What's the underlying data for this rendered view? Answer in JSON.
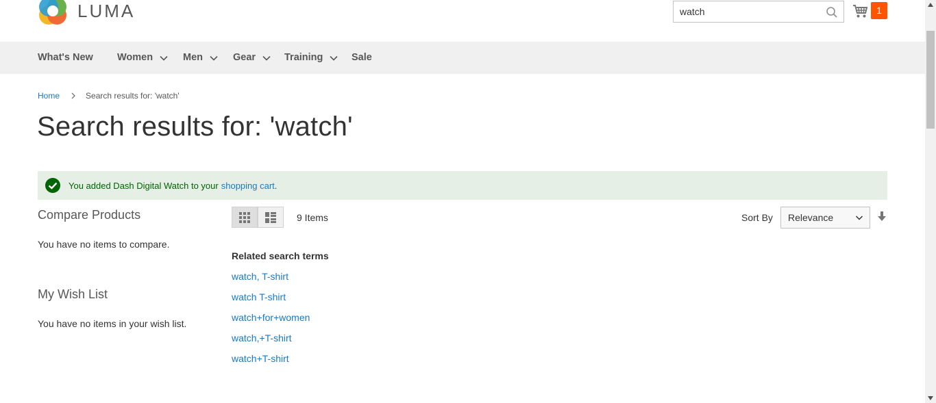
{
  "header": {
    "logo_text": "LUMA",
    "search_value": "watch",
    "cart_count": "1"
  },
  "nav": {
    "items": [
      {
        "label": "What's New",
        "has_dropdown": false
      },
      {
        "label": "Women",
        "has_dropdown": true
      },
      {
        "label": "Men",
        "has_dropdown": true
      },
      {
        "label": "Gear",
        "has_dropdown": true
      },
      {
        "label": "Training",
        "has_dropdown": true
      },
      {
        "label": "Sale",
        "has_dropdown": false
      }
    ]
  },
  "breadcrumb": {
    "home": "Home",
    "current": "Search results for: 'watch'"
  },
  "page_title": "Search results for: 'watch'",
  "message": {
    "text": "You added Dash Digital Watch to your",
    "link": "shopping cart",
    "suffix": "."
  },
  "sidebar": {
    "compare_title": "Compare Products",
    "compare_empty": "You have no items to compare.",
    "wishlist_title": "My Wish List",
    "wishlist_empty": "You have no items in your wish list."
  },
  "toolbar": {
    "items_count": "9 Items",
    "sort_label": "Sort By",
    "sort_value": "Relevance"
  },
  "related": {
    "title": "Related search terms",
    "links": [
      "watch, T-shirt",
      "watch T-shirt",
      "watch+for+women",
      "watch,+T-shirt",
      "watch+T-shirt"
    ]
  },
  "colors": {
    "accent_link": "#1979c3",
    "cart_badge": "#ff5501",
    "success_bg": "#e5efe5",
    "success_text": "#006400"
  }
}
